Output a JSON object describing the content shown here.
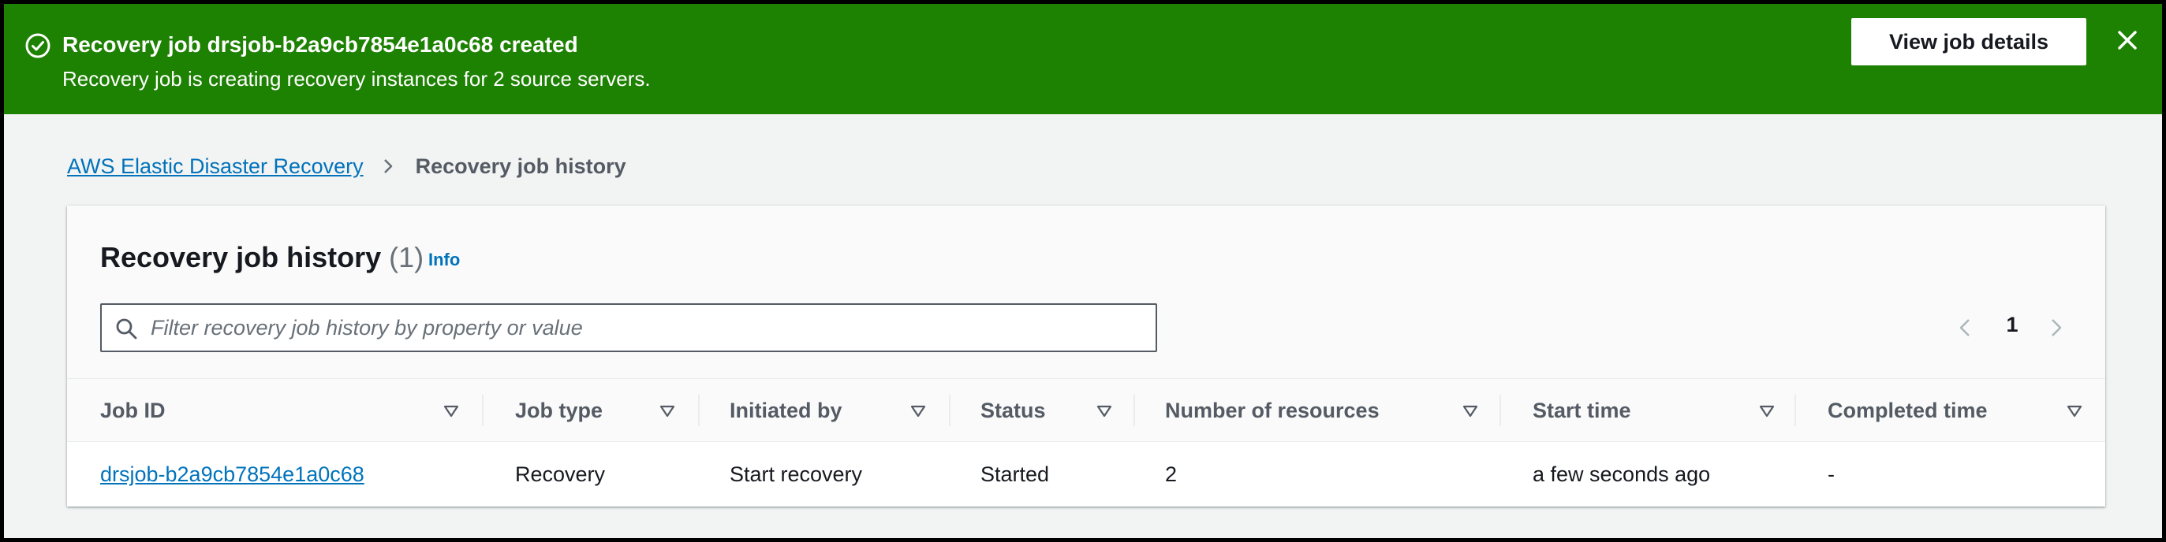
{
  "flash": {
    "type": "success",
    "color": "#1d8102",
    "icon": "check-circle-icon",
    "title": "Recovery job drsjob-b2a9cb7854e1a0c68 created",
    "message": "Recovery job is creating recovery instances for 2 source servers.",
    "action_label": "View job details",
    "dismiss_icon": "close-icon"
  },
  "breadcrumb": {
    "items": [
      {
        "label": "AWS Elastic Disaster Recovery"
      },
      {
        "label": "Recovery job history"
      }
    ]
  },
  "container": {
    "title": "Recovery job history",
    "count": "(1)",
    "info_label": "Info"
  },
  "filter": {
    "placeholder": "Filter recovery job history by property or value",
    "value": ""
  },
  "pagination": {
    "current_page": "1"
  },
  "table": {
    "columns": [
      "Job ID",
      "Job type",
      "Initiated by",
      "Status",
      "Number of resources",
      "Start time",
      "Completed time"
    ],
    "rows": [
      {
        "job_id": "drsjob-b2a9cb7854e1a0c68",
        "job_type": "Recovery",
        "initiated_by": "Start recovery",
        "status": "Started",
        "number_of_resources": "2",
        "start_time": "a few seconds ago",
        "completed_time": "-"
      }
    ]
  },
  "colors": {
    "link": "#0073bb",
    "success": "#1d8102",
    "text": "#16191f",
    "secondary_text": "#545b64"
  }
}
